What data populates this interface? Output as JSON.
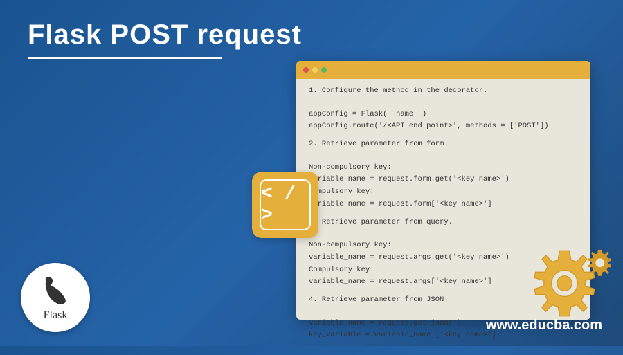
{
  "title": "Flask POST request",
  "code": {
    "section1": {
      "heading": "1. Configure the method in the decorator.",
      "line1": "appConfig = Flask(__name__)",
      "line2": "appConfig.route('/<API end point>', methods = ['POST'])"
    },
    "section2": {
      "heading": "2. Retrieve parameter from form.",
      "sub1": "Non-compulsory key:",
      "line1": "variable_name = request.form.get('<key name>')",
      "sub2": "Compulsory key:",
      "line2": "variable_name = request.form['<key name>']"
    },
    "section3": {
      "heading": "3. Retrieve parameter from query.",
      "sub1": "Non-compulsory key:",
      "line1": "variable_name = request.args.get('<key name>')",
      "sub2": "Compulsory key:",
      "line2": "variable_name = request.args['<key name>']"
    },
    "section4": {
      "heading": "4. Retrieve parameter from JSON.",
      "line1": "variable_name = request.get_json( )",
      "line2": "key_variable = variable_name ['<key name>']"
    }
  },
  "badge": "< / >",
  "logo_text": "Flask",
  "website": "www.educba.com"
}
